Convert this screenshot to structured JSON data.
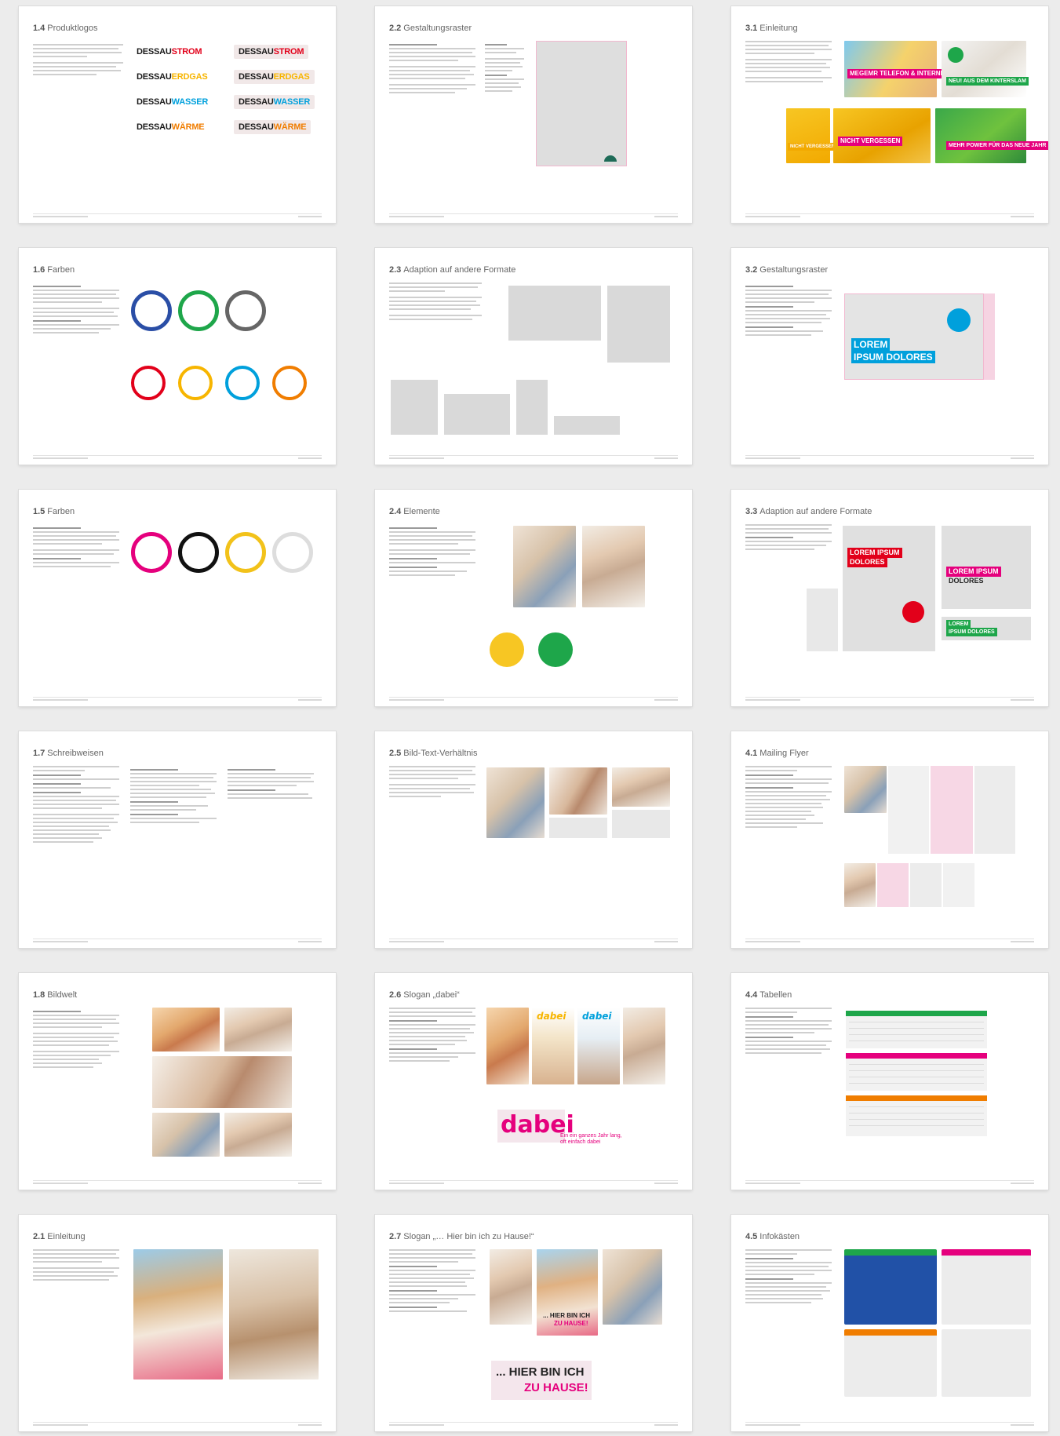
{
  "pages": [
    {
      "num": "1.4",
      "title": "Produktlogos"
    },
    {
      "num": "2.2",
      "title": "Gestaltungsraster"
    },
    {
      "num": "3.1",
      "title": "Einleitung"
    },
    {
      "num": "1.6",
      "title": "Farben"
    },
    {
      "num": "2.3",
      "title": "Adaption auf andere Formate"
    },
    {
      "num": "3.2",
      "title": "Gestaltungsraster"
    },
    {
      "num": "1.5",
      "title": "Farben"
    },
    {
      "num": "2.4",
      "title": "Elemente"
    },
    {
      "num": "3.3",
      "title": "Adaption auf andere Formate"
    },
    {
      "num": "1.7",
      "title": "Schreibweisen"
    },
    {
      "num": "2.5",
      "title": "Bild-Text-Verhältnis"
    },
    {
      "num": "4.1",
      "title": "Mailing Flyer"
    },
    {
      "num": "1.8",
      "title": "Bildwelt"
    },
    {
      "num": "2.6",
      "title": "Slogan „dabei“"
    },
    {
      "num": "4.4",
      "title": "Tabellen"
    },
    {
      "num": "2.1",
      "title": "Einleitung"
    },
    {
      "num": "2.7",
      "title": "Slogan „… Hier bin ich zu Hause!“"
    },
    {
      "num": "4.5",
      "title": "Infokästen"
    }
  ],
  "product_logos": {
    "prefix": "DESSAU",
    "items": [
      {
        "suffix": "STROM",
        "color": "#e2001a"
      },
      {
        "suffix": "ERDGAS",
        "color": "#f7b500"
      },
      {
        "suffix": "WASSER",
        "color": "#00a0dc"
      },
      {
        "suffix": "WÄRME",
        "color": "#f07d00"
      }
    ]
  },
  "ads": {
    "a1": "MEGEMR TELEFON & INTERNET",
    "a2": "NEU! AUS DEM KINTERSLAM",
    "a3": "MEHR POWER FÜR DAS NEUE JAHR",
    "a4": "NICHT VERGESSEN",
    "a5": "NICHT VERGESSEN"
  },
  "lorem": {
    "l1": "LOREM",
    "l2": "IPSUM DOLORES",
    "l3": "LOREM IPSUM",
    "l4": "DOLORES",
    "l5": "LOREM IPSUM",
    "l6": "DOLORES",
    "l7": "LOREM",
    "l8": "IPSUM DOLORES"
  },
  "slogan": {
    "dabei": "dabei",
    "dabei_sub": "Ein ein ganzes Jahr lang, oft einfach dabei",
    "hier_line1": "... HIER BIN ICH",
    "hier_line2": "ZU HAUSE!"
  },
  "colors": {
    "blue": "#2a4ea6",
    "green": "#1ea64a",
    "gray": "#666666",
    "red": "#e2001a",
    "yellow": "#f7b500",
    "cyan": "#00a0dc",
    "orange": "#f07d00",
    "magenta": "#e5007d",
    "black": "#111111",
    "gold": "#f2c21a",
    "silver": "#dddddd"
  }
}
